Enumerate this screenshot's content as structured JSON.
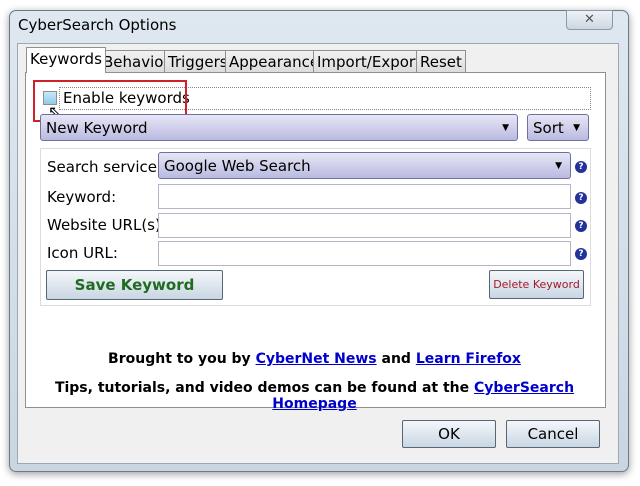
{
  "window": {
    "title": "CyberSearch Options",
    "close_glyph": "✕"
  },
  "tabs": [
    {
      "label": "Keywords"
    },
    {
      "label": "Behavior"
    },
    {
      "label": "Triggers"
    },
    {
      "label": "Appearance"
    },
    {
      "label": "Import/Export"
    },
    {
      "label": "Reset"
    }
  ],
  "enable": {
    "label": "Enable keywords",
    "checked": false
  },
  "keyword_select": {
    "value": "New Keyword"
  },
  "sort": {
    "label": "Sort"
  },
  "form": {
    "search_service_label": "Search service:",
    "search_service_value": "Google Web Search",
    "keyword_label": "Keyword:",
    "keyword_value": "",
    "website_label": "Website URL(s):",
    "website_value": "",
    "icon_label": "Icon URL:",
    "icon_value": "",
    "help_glyph": "?"
  },
  "buttons": {
    "save": "Save Keyword",
    "delete": "Delete Keyword",
    "ok": "OK",
    "cancel": "Cancel"
  },
  "footer": {
    "line1_prefix": "Brought to you by ",
    "link1": "CyberNet News",
    "line1_mid": " and ",
    "link2": "Learn Firefox",
    "line2_prefix": "Tips, tutorials, and video demos can be found at the ",
    "link3": "CyberSearch Homepage"
  },
  "colors": {
    "highlight": "#d0202a",
    "save_text": "#1f6b1f",
    "delete_text": "#a01a2a"
  }
}
